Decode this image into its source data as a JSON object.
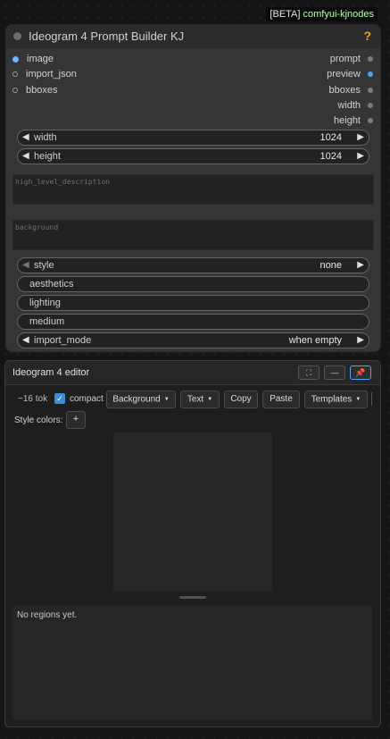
{
  "beta_tag": {
    "prefix": "[BETA] ",
    "name": "comfyui-kjnodes"
  },
  "node": {
    "title": "Ideogram 4 Prompt Builder KJ",
    "help_icon": "?",
    "inputs": [
      {
        "label": "image",
        "connected": true
      },
      {
        "label": "import_json",
        "connected": false
      },
      {
        "label": "bboxes",
        "connected": false
      }
    ],
    "outputs": [
      {
        "label": "prompt"
      },
      {
        "label": "preview"
      },
      {
        "label": "bboxes"
      },
      {
        "label": "width"
      },
      {
        "label": "height"
      }
    ],
    "widgets": {
      "width": {
        "label": "width",
        "value": "1024"
      },
      "height": {
        "label": "height",
        "value": "1024"
      },
      "style": {
        "label": "style",
        "value": "none"
      },
      "aesthetics": {
        "label": "aesthetics"
      },
      "lighting": {
        "label": "lighting"
      },
      "medium": {
        "label": "medium"
      },
      "import_mode": {
        "label": "import_mode",
        "value": "when empty"
      }
    },
    "textareas": {
      "high_level": {
        "placeholder": "high_level_description"
      },
      "background": {
        "placeholder": "background"
      }
    },
    "arrows": {
      "left": "◀",
      "right": "▶"
    }
  },
  "editor": {
    "title": "Ideogram 4 editor",
    "header_buttons": {
      "fullscreen": "⛶",
      "minimize": "—",
      "pin": "📌"
    },
    "toolbar": {
      "token_count": "~16 tok",
      "compact_label": "compact",
      "compact_checked": true,
      "checkmark": "✓",
      "background_btn": "Background",
      "text_btn": "Text",
      "copy_btn": "Copy",
      "paste_btn": "Paste",
      "templates_btn": "Templates",
      "caret": "▼"
    },
    "style_colors_label": "Style colors:",
    "plus_label": "+",
    "regions_empty": "No regions yet."
  },
  "colors": {
    "accent": "#4aa4ff",
    "checkbox": "#3d8bd9",
    "help": "#f0a020",
    "beta_name": "#b8ffb0"
  }
}
